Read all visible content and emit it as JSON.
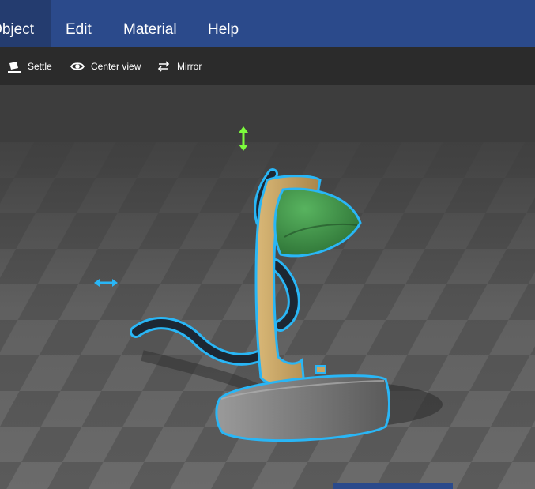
{
  "menu": {
    "items": [
      {
        "label": "Object",
        "active": true
      },
      {
        "label": "Edit"
      },
      {
        "label": "Material"
      },
      {
        "label": "Help"
      }
    ]
  },
  "toolbar": {
    "settle_label": "Settle",
    "center_view_label": "Center view",
    "mirror_label": "Mirror"
  },
  "colors": {
    "menubar": "#2b4a8b",
    "menubar_active": "#243c6f",
    "toolbar": "#2b2b2b",
    "selection_outline": "#29b6f6",
    "vertical_gizmo": "#7cfc3c",
    "horizontal_gizmo": "#29b6f6",
    "lamp_shade": "#3f9b4a",
    "lamp_arm": "#c8a464",
    "lamp_base": "#8a8a8a",
    "cord": "#1d2733"
  },
  "icons": {
    "settle": "settle-cube-icon",
    "center_view": "eye-icon",
    "mirror": "swap-arrows-icon",
    "move_vertical": "vertical-arrow-gizmo-icon",
    "move_horizontal": "horizontal-arrow-gizmo-icon"
  },
  "scene": {
    "object": "desk-lamp-model",
    "selected": true
  }
}
